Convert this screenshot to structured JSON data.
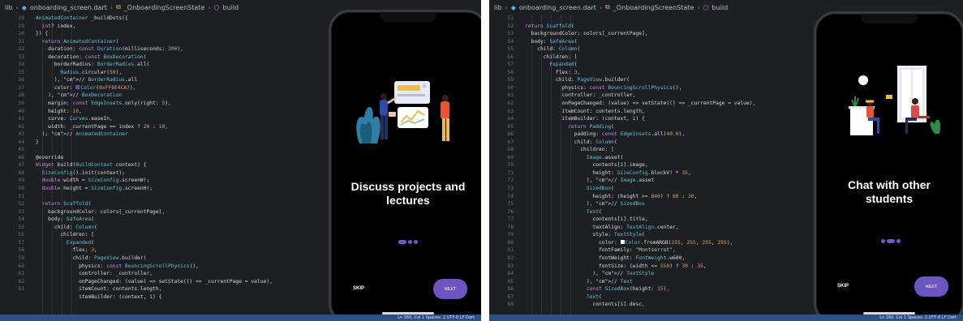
{
  "left": {
    "breadcrumb": [
      "lib",
      "onboarding_screen.dart",
      "_OnboardingScreenState",
      "build"
    ],
    "line_numbers": [
      "28",
      "29",
      "30",
      "31",
      "32",
      "33",
      "34",
      "35",
      "36",
      "37",
      "38",
      "39",
      "40",
      "41",
      "42",
      "43",
      "44",
      "45",
      "46",
      "47",
      "48",
      "49",
      "50",
      "51",
      "52",
      "53",
      "54",
      "55",
      "56",
      "57",
      "58",
      "59",
      "60",
      "61",
      "62",
      "63"
    ],
    "code_lines": [
      "AnimatedContainer _buildDots({",
      "  int? index,",
      "}) {",
      "  return AnimatedContainer(",
      "    duration: const Duration(milliseconds: 200),",
      "    decoration: const BoxDecoration(",
      "      borderRadius: BorderRadius.all(",
      "        Radius.circular(50),",
      "      ), // BorderRadius.all",
      "      color: ■Color(0xFF6E4CA7),",
      "    ), // BoxDecoration",
      "    margin: const EdgeInsets.only(right: 5),",
      "    height: 10,",
      "    curve: Curves.easeIn,",
      "    width: _currentPage == index ? 20 : 10,",
      "  ); // AnimatedContainer",
      "}",
      "",
      "@override",
      "Widget build(BuildContext context) {",
      "  SizeConfig().init(context);",
      "  double width = SizeConfig.screenW!;",
      "  double height = SizeConfig.screenH!;",
      "",
      "  return Scaffold(",
      "    backgroundColor: colors[_currentPage],",
      "    body: SafeArea(",
      "      child: Column(",
      "        children: [",
      "          Expanded(",
      "            flex: 3,",
      "            child: PageView.builder(",
      "              physics: const BouncingScrollPhysics(),",
      "              controller: _controller,",
      "              onPageChanged: (value) => setState(() => _currentPage = value),",
      "              itemCount: contents.length,",
      "              itemBuilder: (context, i) {"
    ],
    "status": "Ln 160, Col 1   Spaces: 2   UTF-8   LF   Dart",
    "phone": {
      "title": "Discuss projects and lectures",
      "skip_label": "SKIP",
      "next_label": "NEXT",
      "active_dot": 0,
      "dot_count": 3
    }
  },
  "right": {
    "breadcrumb": [
      "lib",
      "onboarding_screen.dart",
      "_OnboardingScreenState",
      "build"
    ],
    "line_numbers": [
      "51",
      "52",
      "53",
      "54",
      "55",
      "56",
      "57",
      "58",
      "59",
      "60",
      "61",
      "62",
      "63",
      "64",
      "65",
      "66",
      "67",
      "68",
      "69",
      "70",
      "71",
      "72",
      "73",
      "74",
      "75",
      "76",
      "77",
      "78",
      "79",
      "80",
      "81",
      "82",
      "83",
      "84",
      "85",
      "86",
      "87",
      "88"
    ],
    "code_lines": [
      "",
      "return Scaffold(",
      "  backgroundColor: colors[_currentPage],",
      "  body: SafeArea(",
      "    child: Column(",
      "      children: [",
      "        Expanded(",
      "          flex: 3,",
      "          child: PageView.builder(",
      "            physics: const BouncingScrollPhysics(),",
      "            controller: _controller,",
      "            onPageChanged: (value) => setState(() => _currentPage = value),",
      "            itemCount: contents.length,",
      "            itemBuilder: (context, i) {",
      "              return Padding(",
      "                padding: const EdgeInsets.all(40.0),",
      "                child: Column(",
      "                  children: [",
      "                    Image.asset(",
      "                      contents[i].image,",
      "                      height: SizeConfig.blockV! * 35,",
      "                    ), // Image.asset",
      "                    SizedBox(",
      "                      height: (height >= 840) ? 60 : 30,",
      "                    ), // SizedBox",
      "                    Text(",
      "                      contents[i].title,",
      "                      textAlign: TextAlign.center,",
      "                      style: TextStyle(",
      "                        color: ■Color.fromARGB(255, 255, 255, 255),",
      "                        fontFamily: \"Montserrat\",",
      "                        fontWeight: FontWeight.w600,",
      "                        fontSize: (width <= 550) ? 30 : 35,",
      "                      ), // TextStyle",
      "                    ), // Text",
      "                    const SizedBox(height: 15),",
      "                    Text(",
      "                      contents[i].desc,"
    ],
    "status": "Ln 160, Col 1   Spaces: 2   UTF-8   LF   Dart",
    "phone": {
      "title": "Chat with other students",
      "skip_label": "SKIP",
      "next_label": "NEXT",
      "active_dot": 1,
      "dot_count": 3
    }
  },
  "colors": {
    "editor_bg": "#1e1f22",
    "accent": "#6c55c0",
    "dot": "#7257c7",
    "swatch_left": "#6E4CA7",
    "swatch_right": "#FFFFFF"
  }
}
